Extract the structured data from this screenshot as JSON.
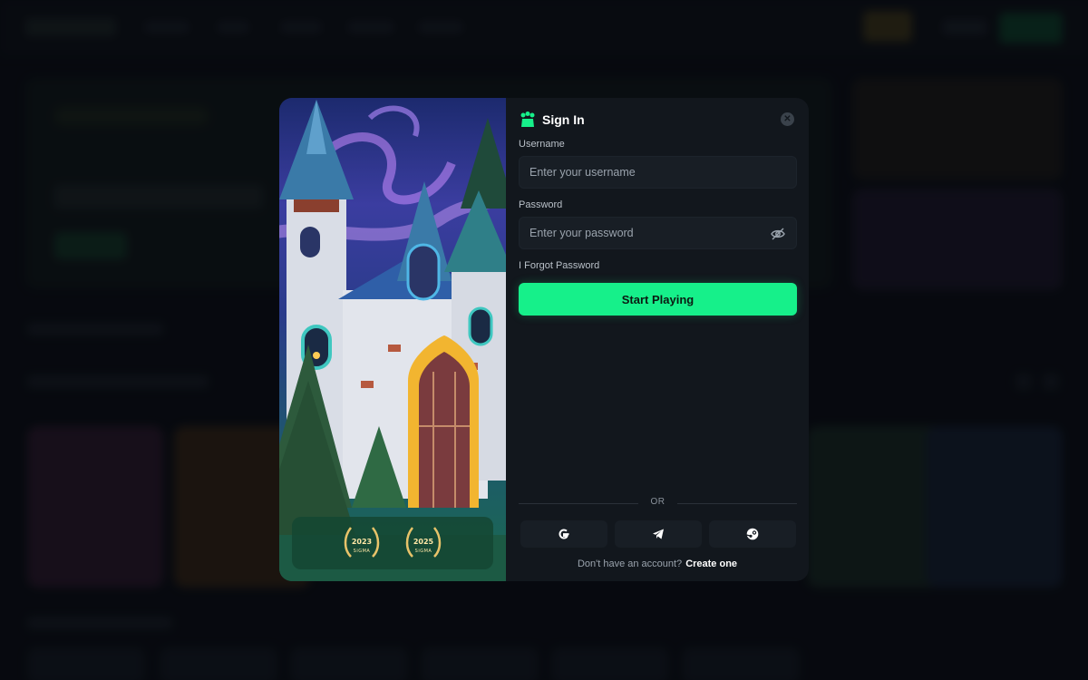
{
  "modal": {
    "title": "Sign In",
    "username": {
      "label": "Username",
      "placeholder": "Enter your username",
      "value": ""
    },
    "password": {
      "label": "Password",
      "placeholder": "Enter your password",
      "value": ""
    },
    "forgot_label": "I Forgot Password",
    "submit_label": "Start Playing",
    "divider_label": "OR",
    "social": [
      {
        "icon": "google-icon"
      },
      {
        "icon": "telegram-icon"
      },
      {
        "icon": "steam-icon"
      }
    ],
    "footer": {
      "prompt": "Don't have an account?",
      "link": "Create one"
    }
  },
  "awards": [
    {
      "year": "2023",
      "org": "SiGMA"
    },
    {
      "year": "2025",
      "org": "SiGMA"
    }
  ],
  "colors": {
    "accent": "#16f08a",
    "modal_bg": "#12171d",
    "input_bg": "#181e25"
  }
}
